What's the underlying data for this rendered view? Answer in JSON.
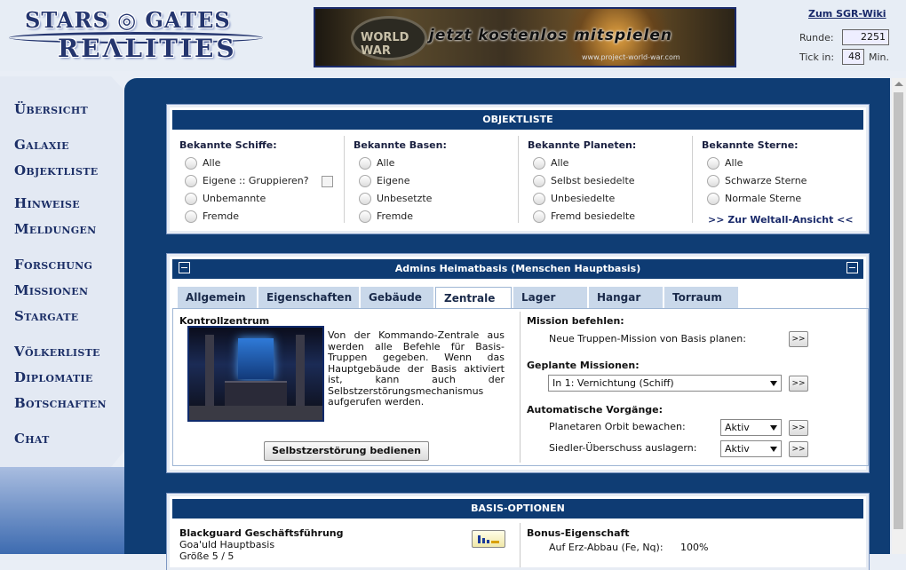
{
  "header": {
    "logo_line1": "STARS ◎ GATES",
    "logo_line2": "REΛLITIES",
    "banner_badge": "WORLD WAR",
    "banner_slogan": "jetzt kostenlos mitspielen",
    "banner_url": "www.project-world-war.com",
    "wiki_link": "Zum SGR-Wiki",
    "round_label": "Runde:",
    "round_value": "2251",
    "tick_label": "Tick in:",
    "tick_value": "48",
    "tick_unit": "Min."
  },
  "sidebar": {
    "items": [
      {
        "label": "Übersicht"
      },
      {
        "label": "Galaxie"
      },
      {
        "label": "Objektliste"
      },
      {
        "label": "Hinweise"
      },
      {
        "label": "Meldungen"
      },
      {
        "label": "Forschung"
      },
      {
        "label": "Missionen"
      },
      {
        "label": "Stargate"
      },
      {
        "label": "Völkerliste"
      },
      {
        "label": "Diplomatie"
      },
      {
        "label": "Botschaften"
      },
      {
        "label": "Chat"
      }
    ]
  },
  "objektliste": {
    "title": "OBJEKTLISTE",
    "columns": [
      {
        "head": "Bekannte Schiffe:",
        "options": [
          "Alle",
          "Eigene :: Gruppieren?",
          "Unbemannte",
          "Fremde"
        ]
      },
      {
        "head": "Bekannte Basen:",
        "options": [
          "Alle",
          "Eigene",
          "Unbesetzte",
          "Fremde"
        ]
      },
      {
        "head": "Bekannte Planeten:",
        "options": [
          "Alle",
          "Selbst besiedelte",
          "Unbesiedelte",
          "Fremd besiedelte"
        ]
      },
      {
        "head": "Bekannte Sterne:",
        "options": [
          "Alle",
          "Schwarze Sterne",
          "Normale Sterne"
        ]
      }
    ],
    "universe_link": ">> Zur Weltall-Ansicht <<"
  },
  "base": {
    "title": "Admins Heimatbasis  (Menschen Hauptbasis)",
    "tabs": [
      "Allgemein",
      "Eigenschaften",
      "Gebäude",
      "Zentrale",
      "Lager",
      "Hangar",
      "Torraum"
    ],
    "active_tab": "Zentrale",
    "section_title": "Kontrollzentrum",
    "description": "Von der Kommando-Zentrale aus werden alle Befehle für Basis-Truppen gegeben. Wenn das Hauptgebäude der Basis aktiviert ist, kann auch der Selbstzerstörungsmechanismus aufgerufen werden.",
    "selfdestruct_button": "Selbstzerstörung bedienen",
    "mission_heading": "Mission befehlen:",
    "mission_text": "Neue Truppen-Mission von Basis planen:",
    "planned_heading": "Geplante Missionen:",
    "planned_select": "In 1: Vernichtung (Schiff)",
    "auto_heading": "Automatische Vorgänge:",
    "orbit_label": "Planetaren Orbit bewachen:",
    "orbit_value": "Aktiv",
    "settler_label": "Siedler-Überschuss auslagern:",
    "settler_value": "Aktiv",
    "go_button": ">>"
  },
  "basis_optionen": {
    "title": "BASIS-OPTIONEN",
    "left_name": "Blackguard Geschäftsführung",
    "left_type": "Goa'uld Hauptbasis",
    "left_size": "Größe 5 / 5",
    "right_heading": "Bonus-Eigenschaft",
    "bonus_label": "Auf Erz-Abbau (Fe, Nq):",
    "bonus_value": "100%"
  }
}
